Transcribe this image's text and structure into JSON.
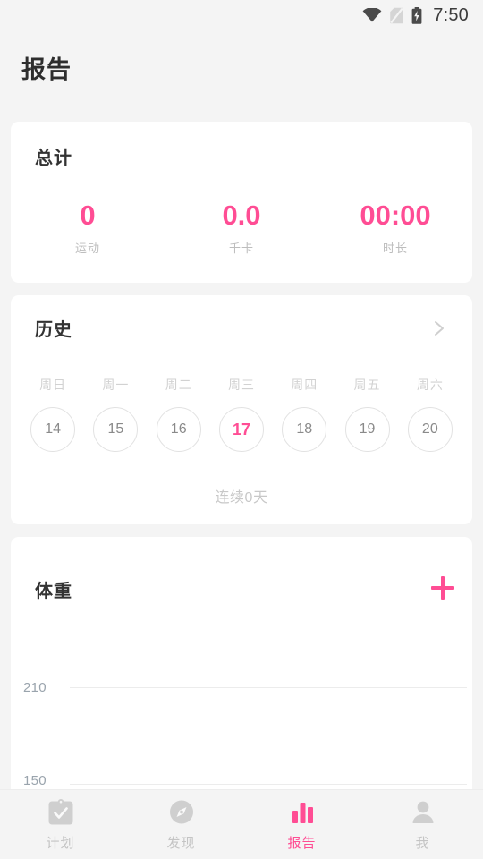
{
  "statusbar": {
    "time": "7:50",
    "icons": [
      {
        "name": "wifi-icon",
        "label": "wifi"
      },
      {
        "name": "no-sim-icon",
        "label": "no-sim"
      },
      {
        "name": "battery-charging-icon",
        "label": "battery-charging"
      }
    ]
  },
  "page": {
    "title": "报告"
  },
  "colors": {
    "accent": "#ff4d94",
    "background": "#f4f4f4",
    "card": "#ffffff",
    "muted": "#c4c4c4",
    "axis_text": "#9aa4ad"
  },
  "total_card": {
    "title": "总计",
    "stats": [
      {
        "value": "0",
        "label": "运动"
      },
      {
        "value": "0.0",
        "label": "千卡"
      },
      {
        "value": "00:00",
        "label": "时长"
      }
    ]
  },
  "history_card": {
    "title": "历史",
    "chevron": "chevron-right-icon",
    "weekdays": [
      "周日",
      "周一",
      "周二",
      "周三",
      "周四",
      "周五",
      "周六"
    ],
    "days": [
      {
        "day": "14",
        "active": false
      },
      {
        "day": "15",
        "active": false
      },
      {
        "day": "16",
        "active": false
      },
      {
        "day": "17",
        "active": true
      },
      {
        "day": "18",
        "active": false
      },
      {
        "day": "19",
        "active": false
      },
      {
        "day": "20",
        "active": false
      }
    ],
    "streak": "连续0天"
  },
  "weight_card": {
    "title": "体重",
    "add_button": "plus-icon"
  },
  "chart_data": {
    "type": "line",
    "title": "体重",
    "xlabel": "",
    "ylabel": "",
    "yticks": [
      "210",
      "150"
    ],
    "ylim": [
      150,
      210
    ],
    "grid": true,
    "series": [
      {
        "name": "体重",
        "values": []
      }
    ],
    "x": []
  },
  "bottomnav": {
    "items": [
      {
        "label": "计划",
        "icon": "clipboard-check-icon",
        "active": false
      },
      {
        "label": "发现",
        "icon": "compass-icon",
        "active": false
      },
      {
        "label": "报告",
        "icon": "bar-chart-icon",
        "active": true
      },
      {
        "label": "我",
        "icon": "person-icon",
        "active": false
      }
    ]
  }
}
